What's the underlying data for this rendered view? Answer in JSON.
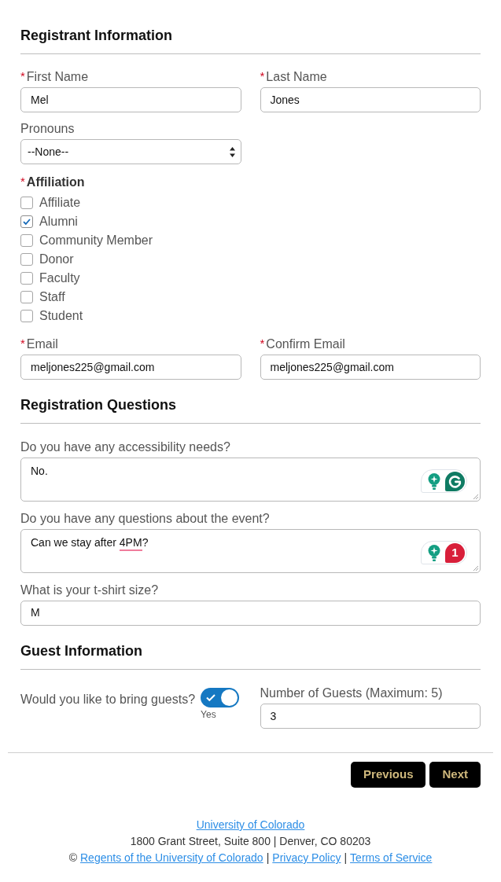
{
  "registrant": {
    "heading": "Registrant Information",
    "first_name": {
      "label": "First Name",
      "asterisk": "*",
      "value": "Mel"
    },
    "last_name": {
      "label": "Last Name",
      "asterisk": "*",
      "value": "Jones"
    },
    "pronouns": {
      "label": "Pronouns",
      "value": "--None--"
    },
    "affiliation": {
      "label": "Affiliation",
      "asterisk": "*",
      "options": [
        {
          "label": "Affiliate",
          "checked": false
        },
        {
          "label": "Alumni",
          "checked": true
        },
        {
          "label": "Community Member",
          "checked": false
        },
        {
          "label": "Donor",
          "checked": false
        },
        {
          "label": "Faculty",
          "checked": false
        },
        {
          "label": "Staff",
          "checked": false
        },
        {
          "label": "Student",
          "checked": false
        }
      ]
    },
    "email": {
      "label": "Email",
      "asterisk": "*",
      "value": "meljones225@gmail.com"
    },
    "confirm_email": {
      "label": "Confirm Email",
      "asterisk": "*",
      "value": "meljones225@gmail.com"
    }
  },
  "questions": {
    "heading": "Registration Questions",
    "items": [
      {
        "kind": "textarea",
        "label": "Do you have any accessibility needs?",
        "value": [
          {
            "text": "No.",
            "flagged": false
          }
        ],
        "assistant": {
          "kind": "logo"
        }
      },
      {
        "kind": "textarea",
        "label": "Do you have any questions about the event?",
        "value": [
          {
            "text": "Can we stay after ",
            "flagged": false
          },
          {
            "text": "4PM",
            "flagged": true
          },
          {
            "text": "?",
            "flagged": false
          }
        ],
        "assistant": {
          "kind": "alerts",
          "count": "1"
        }
      },
      {
        "kind": "input",
        "label": "What is your t-shirt size?",
        "value": [
          {
            "text": "M",
            "flagged": false
          }
        ]
      }
    ]
  },
  "guests": {
    "heading": "Guest Information",
    "bring": {
      "label": "Would you like to bring guests?",
      "on": true,
      "state_label": "Yes"
    },
    "number": {
      "label": "Number of Guests (Maximum: 5)",
      "value": "3"
    }
  },
  "buttons": [
    {
      "label": "Previous"
    },
    {
      "label": "Next"
    }
  ],
  "footer": {
    "org_link": "University of Colorado",
    "address": "1800 Grant Street, Suite 800 | Denver, CO 80203",
    "legal_line": [
      {
        "kind": "symbol",
        "text": "©"
      },
      {
        "kind": "link",
        "text": "Regents of the University of Colorado"
      },
      {
        "kind": "separator",
        "text": "|"
      },
      {
        "kind": "link",
        "text": "Privacy Policy"
      },
      {
        "kind": "separator",
        "text": "|"
      },
      {
        "kind": "link",
        "text": "Terms of Service"
      }
    ]
  }
}
